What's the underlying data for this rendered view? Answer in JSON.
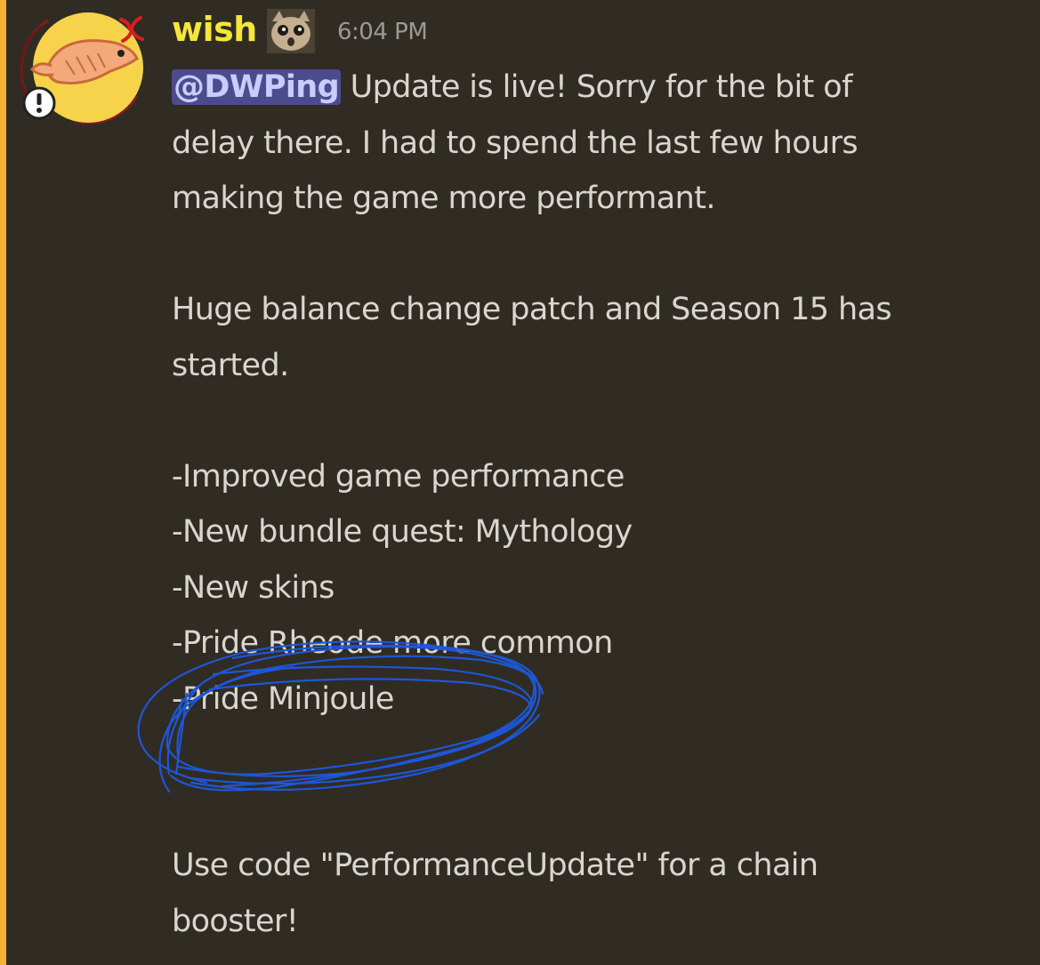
{
  "message": {
    "author": "wish",
    "timestamp": "6:04 PM",
    "mention": "@DWPing",
    "lines": {
      "line1": "Update is live! Sorry for the bit of",
      "line2": "delay there. I had to spend the last few hours",
      "line3": "making the game more performant.",
      "line4": "Huge balance change patch and Season 15 has",
      "line5": "started.",
      "line6": "-Improved game performance",
      "line7": "-New bundle quest: Mythology",
      "line8": "-New skins",
      "line9": "-Pride Rheode more common",
      "line10": "-Pride Minjoule",
      "line11": "Use code \"PerformanceUpdate\" for a chain",
      "line12": "booster!"
    }
  },
  "icons": {
    "avatar": "fish-avatar",
    "role": "cat-emoji-icon",
    "status": "exclamation-badge-icon"
  },
  "colors": {
    "background": "#302c24",
    "highlight_bar": "#f0b232",
    "username": "#f5e63a",
    "text": "#d8d6ce",
    "timestamp": "#9b9a93",
    "mention_bg": "#4c4b8e",
    "annotation": "#1e56d6"
  }
}
